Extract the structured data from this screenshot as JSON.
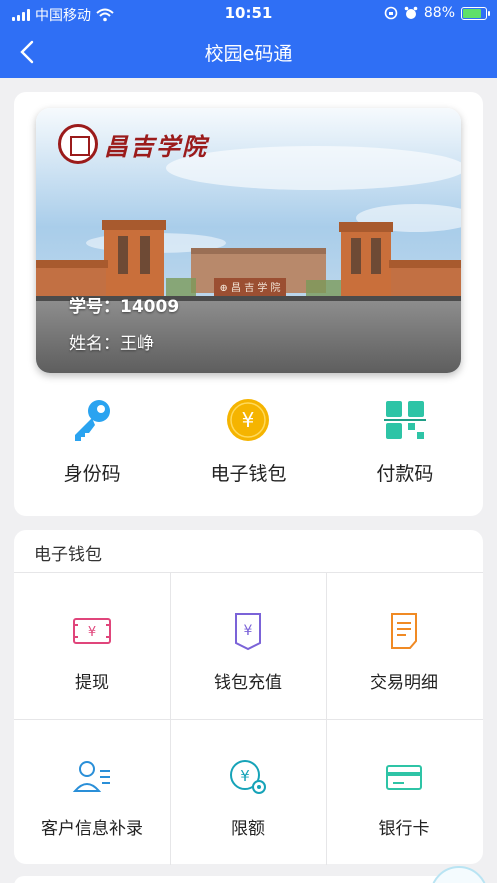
{
  "status": {
    "carrier": "中国移动",
    "time": "10:51",
    "battery": "88%",
    "battery_level": 0.88
  },
  "nav": {
    "title": "校园e码通"
  },
  "campus_card": {
    "school_name": "昌吉学院",
    "student_id_line": "学号：14009",
    "name_line": "姓名：王峥"
  },
  "quick_actions": [
    {
      "label": "身份码",
      "icon": "key-icon"
    },
    {
      "label": "电子钱包",
      "icon": "yuan-coin-icon"
    },
    {
      "label": "付款码",
      "icon": "qr-code-icon"
    }
  ],
  "wallet": {
    "title": "电子钱包",
    "items": [
      {
        "label": "提现",
        "icon": "withdraw-icon"
      },
      {
        "label": "钱包充值",
        "icon": "wallet-recharge-icon"
      },
      {
        "label": "交易明细",
        "icon": "transaction-details-icon"
      },
      {
        "label": "客户信息补录",
        "icon": "customer-info-icon"
      },
      {
        "label": "限额",
        "icon": "limit-icon"
      },
      {
        "label": "银行卡",
        "icon": "bank-card-icon"
      }
    ]
  },
  "colors": {
    "header": "#2f6ff5",
    "accent_yellow": "#f5b400",
    "accent_teal": "#2ec4a6",
    "seal_red": "#9b1b1b"
  }
}
